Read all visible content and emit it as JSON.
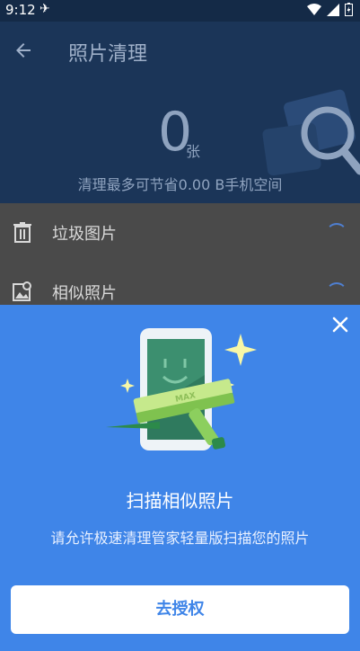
{
  "statusbar": {
    "time": "9:12"
  },
  "header": {
    "title": "照片清理",
    "count": "0",
    "unit": "张",
    "save_text": "清理最多可节省0.00 B手机空间"
  },
  "list": [
    {
      "label": "垃圾图片",
      "icon": "trash-icon"
    },
    {
      "label": "相似照片",
      "icon": "image-icon"
    }
  ],
  "sheet": {
    "title": "扫描相似照片",
    "description": "请允许极速清理管家轻量版扫描您的照片",
    "button_label": "去授权",
    "illustration_badge": "MAX"
  },
  "colors": {
    "header_bg": "#1b3558",
    "sheet_bg": "#3f85e8",
    "accent": "#3f85e8"
  }
}
